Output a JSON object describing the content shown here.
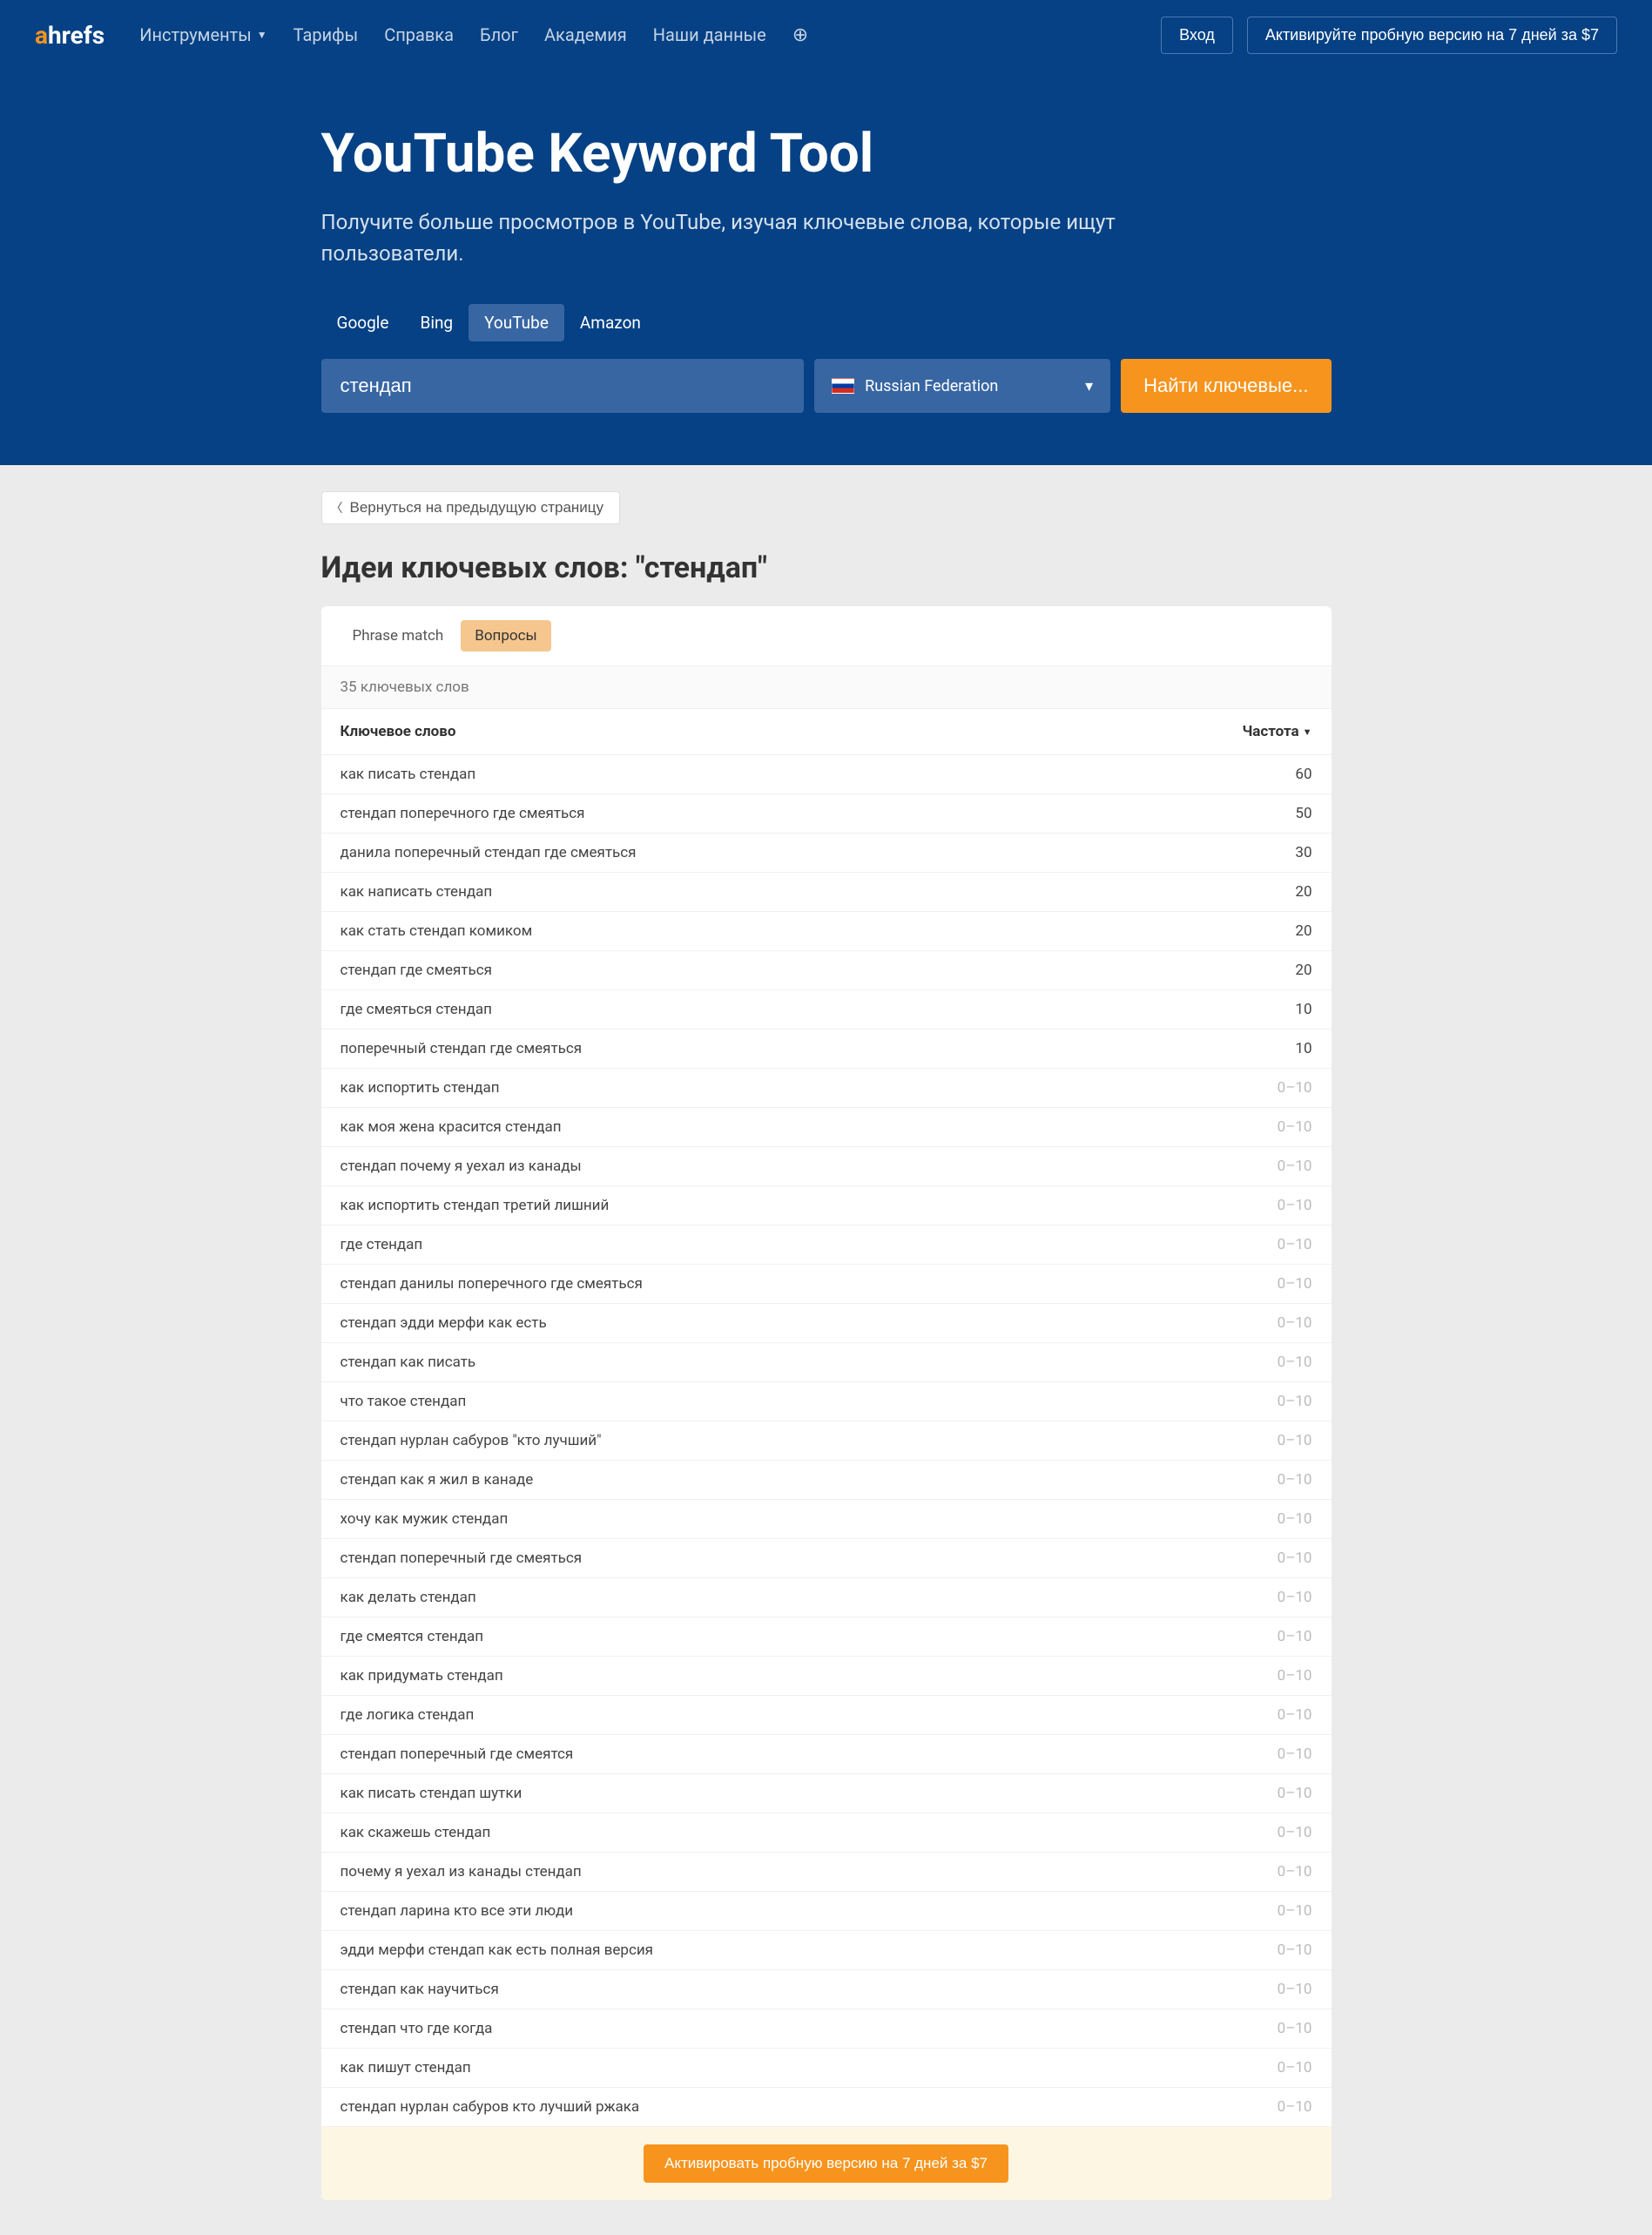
{
  "header": {
    "logo_a": "a",
    "logo_rest": "hrefs",
    "nav": {
      "tools": "Инструменты",
      "pricing": "Тарифы",
      "help": "Справка",
      "blog": "Блог",
      "academy": "Академия",
      "data": "Наши данные"
    },
    "login": "Вход",
    "trial": "Активируйте пробную версию на 7 дней за $7"
  },
  "hero": {
    "title": "YouTube Keyword Tool",
    "subtitle": "Получите больше просмотров в YouTube, изучая ключевые слова, которые ищут пользователи.",
    "tabs": {
      "google": "Google",
      "bing": "Bing",
      "youtube": "YouTube",
      "amazon": "Amazon"
    },
    "search_value": "стендап",
    "country": "Russian Federation",
    "search_btn": "Найти ключевые..."
  },
  "content": {
    "back": "Вернуться на предыдущую страницу",
    "title": "Идеи ключевых слов: \"стендап\"",
    "filters": {
      "phrase": "Phrase match",
      "questions": "Вопросы"
    },
    "count": "35 ключевых слов",
    "columns": {
      "keyword": "Ключевое слово",
      "volume": "Частота"
    },
    "rows": [
      {
        "kw": "как писать стендап",
        "vol": "60",
        "dim": false
      },
      {
        "kw": "стендап поперечного где смеяться",
        "vol": "50",
        "dim": false
      },
      {
        "kw": "данила поперечный стендап где смеяться",
        "vol": "30",
        "dim": false
      },
      {
        "kw": "как написать стендап",
        "vol": "20",
        "dim": false
      },
      {
        "kw": "как стать стендап комиком",
        "vol": "20",
        "dim": false
      },
      {
        "kw": "стендап где смеяться",
        "vol": "20",
        "dim": false
      },
      {
        "kw": "где смеяться стендап",
        "vol": "10",
        "dim": false
      },
      {
        "kw": "поперечный стендап где смеяться",
        "vol": "10",
        "dim": false
      },
      {
        "kw": "как испортить стендап",
        "vol": "0–10",
        "dim": true
      },
      {
        "kw": "как моя жена красится стендап",
        "vol": "0–10",
        "dim": true
      },
      {
        "kw": "стендап почему я уехал из канады",
        "vol": "0–10",
        "dim": true
      },
      {
        "kw": "как испортить стендап третий лишний",
        "vol": "0–10",
        "dim": true
      },
      {
        "kw": "где стендап",
        "vol": "0–10",
        "dim": true
      },
      {
        "kw": "стендап данилы поперечного где смеяться",
        "vol": "0–10",
        "dim": true
      },
      {
        "kw": "стендап эдди мерфи как есть",
        "vol": "0–10",
        "dim": true
      },
      {
        "kw": "стендап как писать",
        "vol": "0–10",
        "dim": true
      },
      {
        "kw": "что такое стендап",
        "vol": "0–10",
        "dim": true
      },
      {
        "kw": "стендап нурлан сабуров \"кто лучший\"",
        "vol": "0–10",
        "dim": true
      },
      {
        "kw": "стендап как я жил в канаде",
        "vol": "0–10",
        "dim": true
      },
      {
        "kw": "хочу как мужик стендап",
        "vol": "0–10",
        "dim": true
      },
      {
        "kw": "стендап поперечный где смеяться",
        "vol": "0–10",
        "dim": true
      },
      {
        "kw": "как делать стендап",
        "vol": "0–10",
        "dim": true
      },
      {
        "kw": "где смеятся стендап",
        "vol": "0–10",
        "dim": true
      },
      {
        "kw": "как придумать стендап",
        "vol": "0–10",
        "dim": true
      },
      {
        "kw": "где логика стендап",
        "vol": "0–10",
        "dim": true
      },
      {
        "kw": "стендап поперечный где смеятся",
        "vol": "0–10",
        "dim": true
      },
      {
        "kw": "как писать стендап шутки",
        "vol": "0–10",
        "dim": true
      },
      {
        "kw": "как скажешь стендап",
        "vol": "0–10",
        "dim": true
      },
      {
        "kw": "почему я уехал из канады стендап",
        "vol": "0–10",
        "dim": true
      },
      {
        "kw": "стендап ларина кто все эти люди",
        "vol": "0–10",
        "dim": true
      },
      {
        "kw": "эдди мерфи стендап как есть полная версия",
        "vol": "0–10",
        "dim": true
      },
      {
        "kw": "стендап как научиться",
        "vol": "0–10",
        "dim": true
      },
      {
        "kw": "стендап что где когда",
        "vol": "0–10",
        "dim": true
      },
      {
        "kw": "как пишут стендап",
        "vol": "0–10",
        "dim": true
      },
      {
        "kw": "стендап нурлан сабуров кто лучший ржака",
        "vol": "0–10",
        "dim": true
      }
    ],
    "cta": "Активировать пробную версию на 7 дней за $7"
  }
}
